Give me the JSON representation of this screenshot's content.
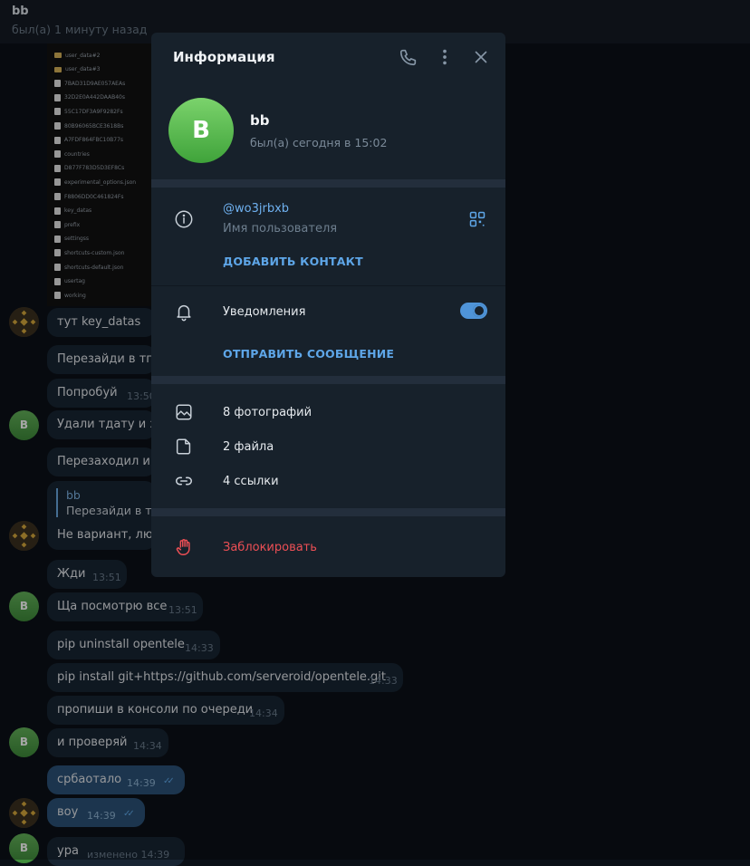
{
  "chat_header": {
    "title": "bb",
    "status": "был(а) 1 минуту назад"
  },
  "files": [
    {
      "name": "user_data#2",
      "type": "folder"
    },
    {
      "name": "user_data#3",
      "type": "folder"
    },
    {
      "name": "7BAD31D9AE057AEAs",
      "type": "file"
    },
    {
      "name": "32D2E0A442DAAB40s",
      "type": "file"
    },
    {
      "name": "55C17DF3A9F9282Fs",
      "type": "file"
    },
    {
      "name": "80B96065BCE3618Bs",
      "type": "file"
    },
    {
      "name": "A7FDF864FBC10B77s",
      "type": "file"
    },
    {
      "name": "countries",
      "type": "file"
    },
    {
      "name": "D877F783D5D3EF8Cs",
      "type": "file"
    },
    {
      "name": "experimental_options.json",
      "type": "file"
    },
    {
      "name": "F8806DD0C461824Fs",
      "type": "file"
    },
    {
      "name": "key_datas",
      "type": "file"
    },
    {
      "name": "prefix",
      "type": "file"
    },
    {
      "name": "settingss",
      "type": "file"
    },
    {
      "name": "shortcuts-custom.json",
      "type": "file"
    },
    {
      "name": "shortcuts-default.json",
      "type": "file"
    },
    {
      "name": "usertag",
      "type": "file"
    },
    {
      "name": "working",
      "type": "file"
    }
  ],
  "messages": [
    {
      "text": "тут key_datas",
      "time": "",
      "checks": false
    },
    {
      "text": "Перезайди в тг",
      "time": "",
      "checks": false
    },
    {
      "text": "Попробуй",
      "time": "13:50",
      "checks": false
    },
    {
      "text": "Удали тдату и зан",
      "time": "",
      "checks": false
    },
    {
      "text": "Перезаходил и о",
      "time": "",
      "checks": false
    },
    {
      "quote_name": "bb",
      "quote_text": "Перезайди в тг",
      "text": "Не вариант, люди",
      "time": "",
      "checks": false
    },
    {
      "text": "Жди",
      "time": "13:51",
      "checks": false
    },
    {
      "text": "Ща посмотрю все",
      "time": "13:51",
      "checks": false
    },
    {
      "text": "pip uninstall opentele",
      "time": "14:33",
      "checks": false
    },
    {
      "text": "pip install git+https://github.com/serveroid/opentele.git",
      "time": "14:33",
      "checks": false
    },
    {
      "text": "пропиши в консоли по очереди",
      "time": "14:34",
      "checks": false
    },
    {
      "text": "и проверяй",
      "time": "14:34",
      "checks": false
    },
    {
      "text": "србаотало",
      "time": "14:39",
      "checks": true
    },
    {
      "text": "воу",
      "time": "14:39",
      "checks": true
    },
    {
      "text": "ура",
      "time": "изменено 14:39",
      "checks": false
    }
  ],
  "avatar_letter": "B",
  "modal": {
    "title": "Информация",
    "profile": {
      "avatar_letter": "B",
      "name": "bb",
      "status": "был(а) сегодня в 15:02"
    },
    "username": {
      "value": "@wo3jrbxb",
      "label": "Имя пользователя"
    },
    "add_contact": "ДОБАВИТЬ КОНТАКТ",
    "notifications": {
      "label": "Уведомления",
      "enabled": true
    },
    "send_message": "ОТПРАВИТЬ СООБЩЕНИЕ",
    "media": {
      "photos": "8 фотографий",
      "files": "2 файла",
      "links": "4 ссылки"
    },
    "block": "Заблокировать"
  },
  "colors": {
    "accent": "#5ea6e8",
    "danger": "#ec4f55",
    "bubble": "#182533",
    "panel": "#17212b",
    "avatar_green": "#4fb84a"
  }
}
